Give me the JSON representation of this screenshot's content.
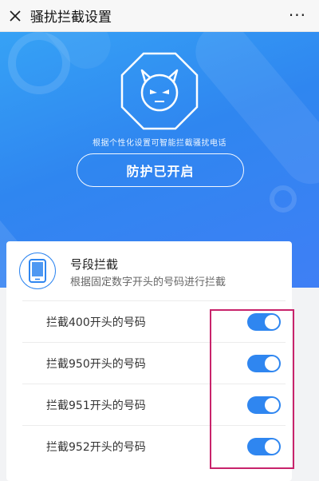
{
  "navbar": {
    "title": "骚扰拦截设置",
    "more_label": "···"
  },
  "hero": {
    "description": "根据个性化设置可智能拦截骚扰电话",
    "protect_button_label": "防护已开启"
  },
  "card": {
    "title": "号段拦截",
    "subtitle": "根据固定数字开头的号码进行拦截",
    "rows": [
      {
        "label": "拦截400开头的号码",
        "enabled": true
      },
      {
        "label": "拦截950开头的号码",
        "enabled": true
      },
      {
        "label": "拦截951开头的号码",
        "enabled": true
      },
      {
        "label": "拦截952开头的号码",
        "enabled": true
      }
    ]
  },
  "colors": {
    "accent": "#2f86f0",
    "highlight": "#c8236b"
  },
  "icons": {
    "close": "close-icon",
    "more": "more-icon",
    "shield": "shield-devil-icon",
    "phone": "phone-icon"
  }
}
